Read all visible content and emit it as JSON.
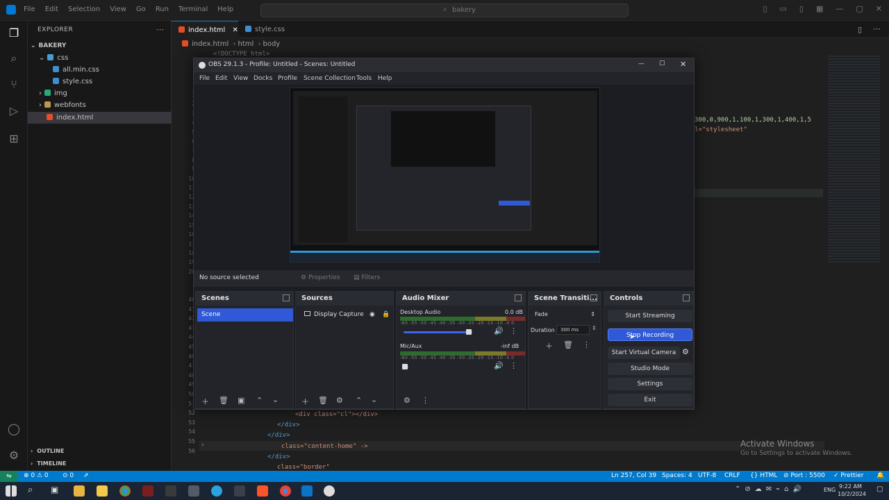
{
  "vscode": {
    "menu": [
      "File",
      "Edit",
      "Selection",
      "View",
      "Go",
      "Run",
      "Terminal",
      "Help"
    ],
    "search_placeholder": "bakery",
    "explorer": {
      "title": "EXPLORER",
      "project": "BAKERY",
      "tree": [
        {
          "label": "css",
          "kind": "folder-open"
        },
        {
          "label": "all.min.css",
          "kind": "css"
        },
        {
          "label": "style.css",
          "kind": "css"
        },
        {
          "label": "img",
          "kind": "folder"
        },
        {
          "label": "webfonts",
          "kind": "folder"
        },
        {
          "label": "index.html",
          "kind": "html"
        }
      ],
      "outline": "OUTLINE",
      "timeline": "TIMELINE"
    },
    "tabs": [
      {
        "label": "index.html",
        "active": true
      },
      {
        "label": "style.css",
        "active": false
      }
    ],
    "breadcrumbs": [
      "index.html",
      "html",
      "body"
    ],
    "code_top": "<!DOCTYPE html>",
    "code_right_1": "300,0,900,1,100,1,300,1,400,1,5",
    "code_right_2": "l=\"stylesheet\"",
    "gutter_top": [
      "1",
      "2",
      "3",
      "4",
      "5",
      "6",
      "7",
      "8",
      "9",
      "10",
      "11",
      "12",
      "13",
      "14",
      "15",
      "16",
      "17",
      "18",
      "19",
      "20",
      "21",
      "22",
      "23",
      "24",
      "25"
    ],
    "gutter_bottom": [
      "40",
      "41",
      "42",
      "43",
      "44",
      "45",
      "46",
      "47",
      "48",
      "49",
      "50",
      "51",
      "52",
      "53",
      "54",
      "55",
      "56"
    ],
    "code_lines": [
      {
        "text": "<div class=\"cl\"></div>",
        "color": "#ce9178"
      },
      {
        "text": "</div>",
        "color": "#569cd6"
      },
      {
        "text": "</div>",
        "color": "#569cd6"
      },
      {
        "text": "class=\"content-home\" ->",
        "color": "#ce9178"
      },
      {
        "text": "</div>",
        "color": "#569cd6"
      },
      {
        "text": "class=\"border\"",
        "color": "#ce9178"
      }
    ],
    "status": {
      "errors": "⊗ 0 ⚠ 0",
      "ports": "0",
      "position": "Ln 257, Col 39",
      "spaces": "Spaces: 4",
      "encoding": "UTF-8",
      "eol": "CRLF",
      "language": "HTML",
      "port": "Port : 5500",
      "prettier": "Prettier"
    },
    "watermark": {
      "title": "Activate Windows",
      "subtitle": "Go to Settings to activate Windows."
    }
  },
  "obs": {
    "title": "OBS 29.1.3 - Profile: Untitled - Scenes: Untitled",
    "menu": [
      "File",
      "Edit",
      "View",
      "Docks",
      "Profile",
      "Scene Collection",
      "Tools",
      "Help"
    ],
    "source_bar": {
      "status": "No source selected",
      "properties": "Properties",
      "filters": "Filters"
    },
    "docks": {
      "scenes": {
        "title": "Scenes",
        "items": [
          "Scene"
        ]
      },
      "sources": {
        "title": "Sources",
        "items": [
          "Display Capture"
        ]
      },
      "audio_mixer": {
        "title": "Audio Mixer",
        "channels": [
          {
            "name": "Desktop Audio",
            "level": "0.0 dB",
            "volume": 0.76
          },
          {
            "name": "Mic/Aux",
            "level": "-inf dB",
            "volume": 0.05
          }
        ],
        "ticks": "-60 -55 -50 -45 -40 -35 -30 -25 -20 -15 -10 -5 0"
      },
      "transitions": {
        "title": "Scene Transiti...",
        "selected": "Fade",
        "duration_label": "Duration",
        "duration_value": "300 ms"
      },
      "controls": {
        "title": "Controls",
        "buttons": [
          {
            "label": "Start Streaming",
            "primary": false
          },
          {
            "label": "Stop Recording",
            "primary": true
          },
          {
            "label": "Start Virtual Camera",
            "primary": false
          },
          {
            "label": "Studio Mode",
            "primary": false
          },
          {
            "label": "Settings",
            "primary": false
          },
          {
            "label": "Exit",
            "primary": false
          }
        ]
      }
    }
  },
  "taskbar": {
    "language": "ENG",
    "time": "9:22 AM",
    "date": "10/2/2024"
  },
  "colors": {
    "accent": "#007acc",
    "obs_primary": "#2f59d6",
    "selected_scene": "#2f59d6"
  }
}
